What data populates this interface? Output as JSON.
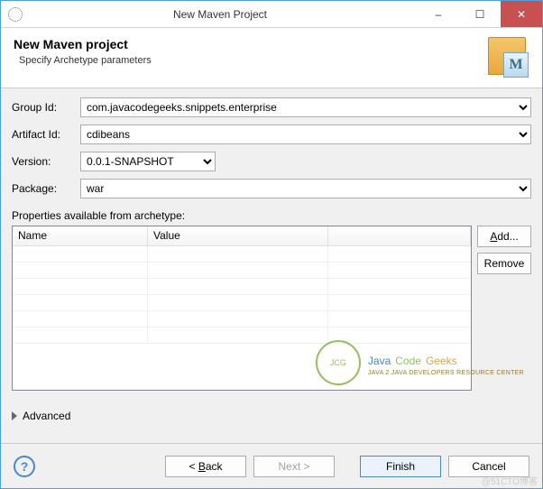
{
  "titlebar": {
    "title": "New Maven Project",
    "minimize": "–",
    "maximize": "☐",
    "close": "✕"
  },
  "banner": {
    "heading": "New Maven project",
    "subheading": "Specify Archetype parameters"
  },
  "form": {
    "groupId": {
      "label": "Group Id:",
      "value": "com.javacodegeeks.snippets.enterprise"
    },
    "artifactId": {
      "label": "Artifact Id:",
      "value": "cdibeans"
    },
    "version": {
      "label": "Version:",
      "value": "0.0.1-SNAPSHOT"
    },
    "package": {
      "label": "Package:",
      "value": "war"
    }
  },
  "properties": {
    "label": "Properties available from archetype:",
    "columns": {
      "name": "Name",
      "value": "Value"
    },
    "buttons": {
      "add": "Add...",
      "remove": "Remove"
    }
  },
  "advanced": {
    "label": "Advanced"
  },
  "footer": {
    "back": "Back",
    "next": "Next >",
    "finish": "Finish",
    "cancel": "Cancel"
  },
  "watermark": {
    "circle": "JCG",
    "line1_java": "Java",
    "line1_code": "Code",
    "line1_geeks": "Geeks",
    "line2": "JAVA 2 JAVA DEVELOPERS RESOURCE CENTER",
    "cto": "@51CTO博客"
  }
}
